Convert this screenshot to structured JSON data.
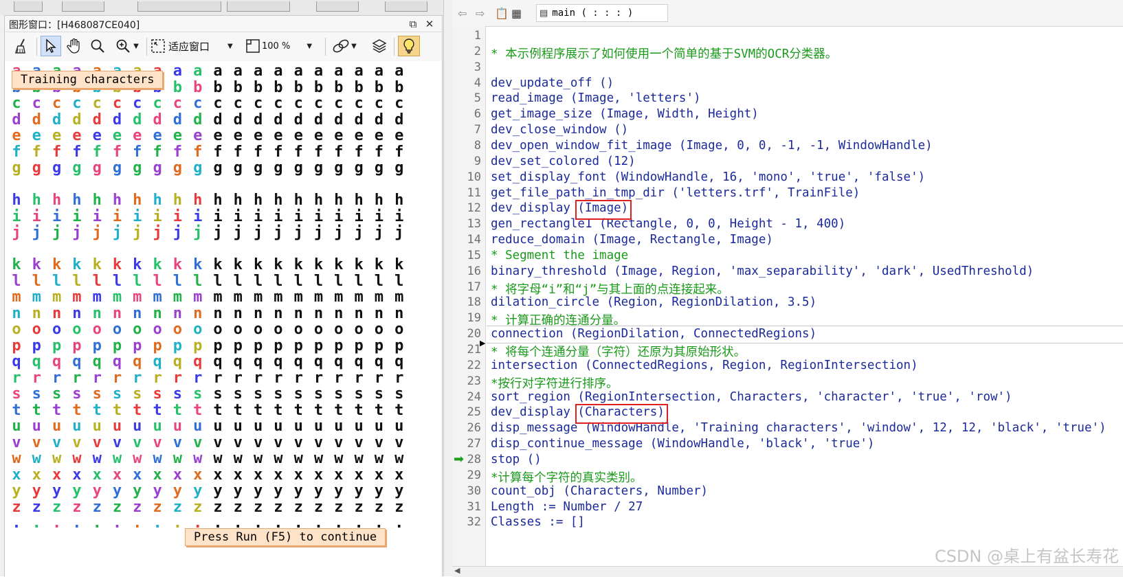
{
  "graphics_window": {
    "title": "图形窗口：[H468087CE040]",
    "toolbar": {
      "fit_label": "适应窗口",
      "zoom_value": "100 %"
    },
    "overlay_top": "Training characters",
    "overlay_bottom": "Press Run (F5) to continue",
    "rows": [
      "a",
      "b",
      "c",
      "d",
      "e",
      "f",
      "g",
      "",
      "h",
      "i",
      "j",
      "",
      "k",
      "l",
      "m",
      "n",
      "o",
      "p",
      "q",
      "r",
      "s",
      "t",
      "u",
      "v",
      "w",
      "x",
      "y",
      "z",
      "."
    ],
    "palette": [
      "#e8457a",
      "#2f6fd6",
      "#20b248",
      "#9a3fd0",
      "#e06a1e",
      "#1fb0c8",
      "#b8b020",
      "#e83a3a",
      "#3a3ae8",
      "#26c06a"
    ],
    "mono_count": 10,
    "color_count": 10
  },
  "editor": {
    "procedure": "main ( : : : )",
    "lines": [
      {
        "n": "1",
        "text": "",
        "kind": "code"
      },
      {
        "n": "2",
        "text": "* 本示例程序展示了如何使用一个简单的基于SVM的OCR分类器。",
        "kind": "comment"
      },
      {
        "n": "3",
        "text": "",
        "kind": "code"
      },
      {
        "n": "4",
        "text": "dev_update_off ()",
        "kind": "code"
      },
      {
        "n": "5",
        "text": "read_image (Image, 'letters')",
        "kind": "code"
      },
      {
        "n": "6",
        "text": "get_image_size (Image, Width, Height)",
        "kind": "code"
      },
      {
        "n": "7",
        "text": "dev_close_window ()",
        "kind": "code"
      },
      {
        "n": "8",
        "text": "dev_open_window_fit_image (Image, 0, 0, -1, -1, WindowHandle)",
        "kind": "code"
      },
      {
        "n": "9",
        "text": "dev_set_colored (12)",
        "kind": "code"
      },
      {
        "n": "10",
        "text": "set_display_font (WindowHandle, 16, 'mono', 'true', 'false')",
        "kind": "code"
      },
      {
        "n": "11",
        "text": "get_file_path_in_tmp_dir ('letters.trf', TrainFile)",
        "kind": "code"
      },
      {
        "n": "12",
        "text": "dev_display (Image)",
        "kind": "code"
      },
      {
        "n": "13",
        "text": "gen_rectangle1 (Rectangle, 0, 0, Height - 1, 400)",
        "kind": "code"
      },
      {
        "n": "14",
        "text": "reduce_domain (Image, Rectangle, Image)",
        "kind": "code"
      },
      {
        "n": "15",
        "text": "* Segment the image",
        "kind": "comment"
      },
      {
        "n": "16",
        "text": "binary_threshold (Image, Region, 'max_separability', 'dark', UsedThreshold)",
        "kind": "code"
      },
      {
        "n": "17",
        "text": "* 将字母“i”和“j”与其上面的点连接起来。",
        "kind": "comment"
      },
      {
        "n": "18",
        "text": "dilation_circle (Region, RegionDilation, 3.5)",
        "kind": "code"
      },
      {
        "n": "19",
        "text": "* 计算正确的连通分量。",
        "kind": "comment"
      },
      {
        "n": "20",
        "text": "connection (RegionDilation, ConnectedRegions)",
        "kind": "code"
      },
      {
        "n": "21",
        "text": "* 将每个连通分量（字符）还原为其原始形状。",
        "kind": "comment"
      },
      {
        "n": "22",
        "text": "intersection (ConnectedRegions, Region, RegionIntersection)",
        "kind": "code"
      },
      {
        "n": "23",
        "text": "*按行对字符进行排序。",
        "kind": "comment"
      },
      {
        "n": "24",
        "text": "sort_region (RegionIntersection, Characters, 'character', 'true', 'row')",
        "kind": "code"
      },
      {
        "n": "25",
        "text": "dev_display (Characters)",
        "kind": "code"
      },
      {
        "n": "26",
        "text": "disp_message (WindowHandle, 'Training characters', 'window', 12, 12, 'black', 'true')",
        "kind": "code"
      },
      {
        "n": "27",
        "text": "disp_continue_message (WindowHandle, 'black', 'true')",
        "kind": "code"
      },
      {
        "n": "28",
        "text": "stop ()",
        "kind": "code"
      },
      {
        "n": "29",
        "text": "*计算每个字符的真实类别。",
        "kind": "comment"
      },
      {
        "n": "30",
        "text": "count_obj (Characters, Number)",
        "kind": "code"
      },
      {
        "n": "31",
        "text": "Length := Number / 27",
        "kind": "code"
      },
      {
        "n": "32",
        "text": "Classes := []",
        "kind": "code"
      }
    ]
  },
  "watermark": "CSDN @桌上有盆长寿花"
}
